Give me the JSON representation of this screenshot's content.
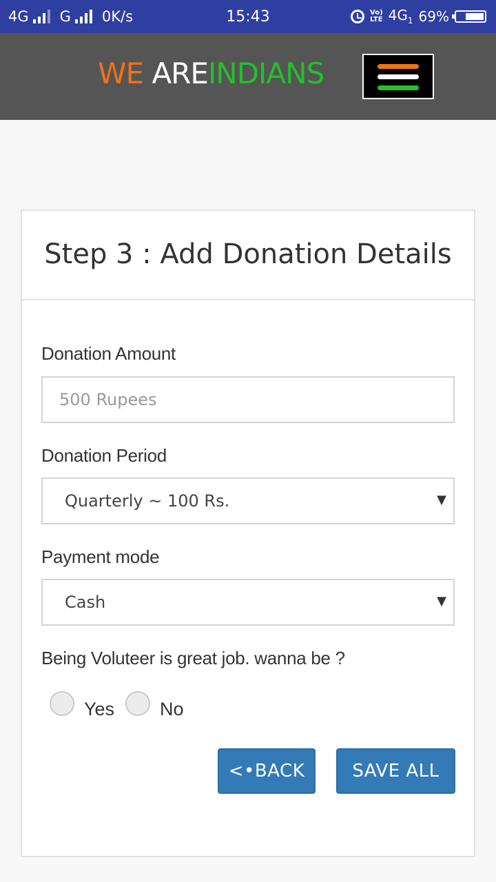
{
  "status_bar": {
    "network1": "4G",
    "network2": "G",
    "speed": "0K/s",
    "time": "15:43",
    "volte_top": "Vo)",
    "volte_bottom": "LTE",
    "network3": "4G",
    "network3_sub": "1",
    "battery": "69%",
    "battery_level": 0.69
  },
  "navbar": {
    "brand_word1": "WE",
    "brand_word2": "ARE",
    "brand_word3": "INDIANS",
    "colors": {
      "saffron": "#f07218",
      "white": "#ffffff",
      "green": "#22c12b",
      "background": "#555555"
    }
  },
  "form": {
    "title": "Step 3 : Add Donation Details",
    "amount_label": "Donation Amount",
    "amount_placeholder": "500 Rupees",
    "amount_value": "",
    "period_label": "Donation Period",
    "period_selected": "Quarterly ~ 100 Rs.",
    "payment_label": "Payment mode",
    "payment_selected": "Cash",
    "volunteer_question": "Being Voluteer is great job. wanna be ?",
    "radio_yes": "Yes",
    "radio_no": "No",
    "back_button": "<•BACK",
    "save_button": "SAVE ALL",
    "button_color": "#337ab7"
  }
}
